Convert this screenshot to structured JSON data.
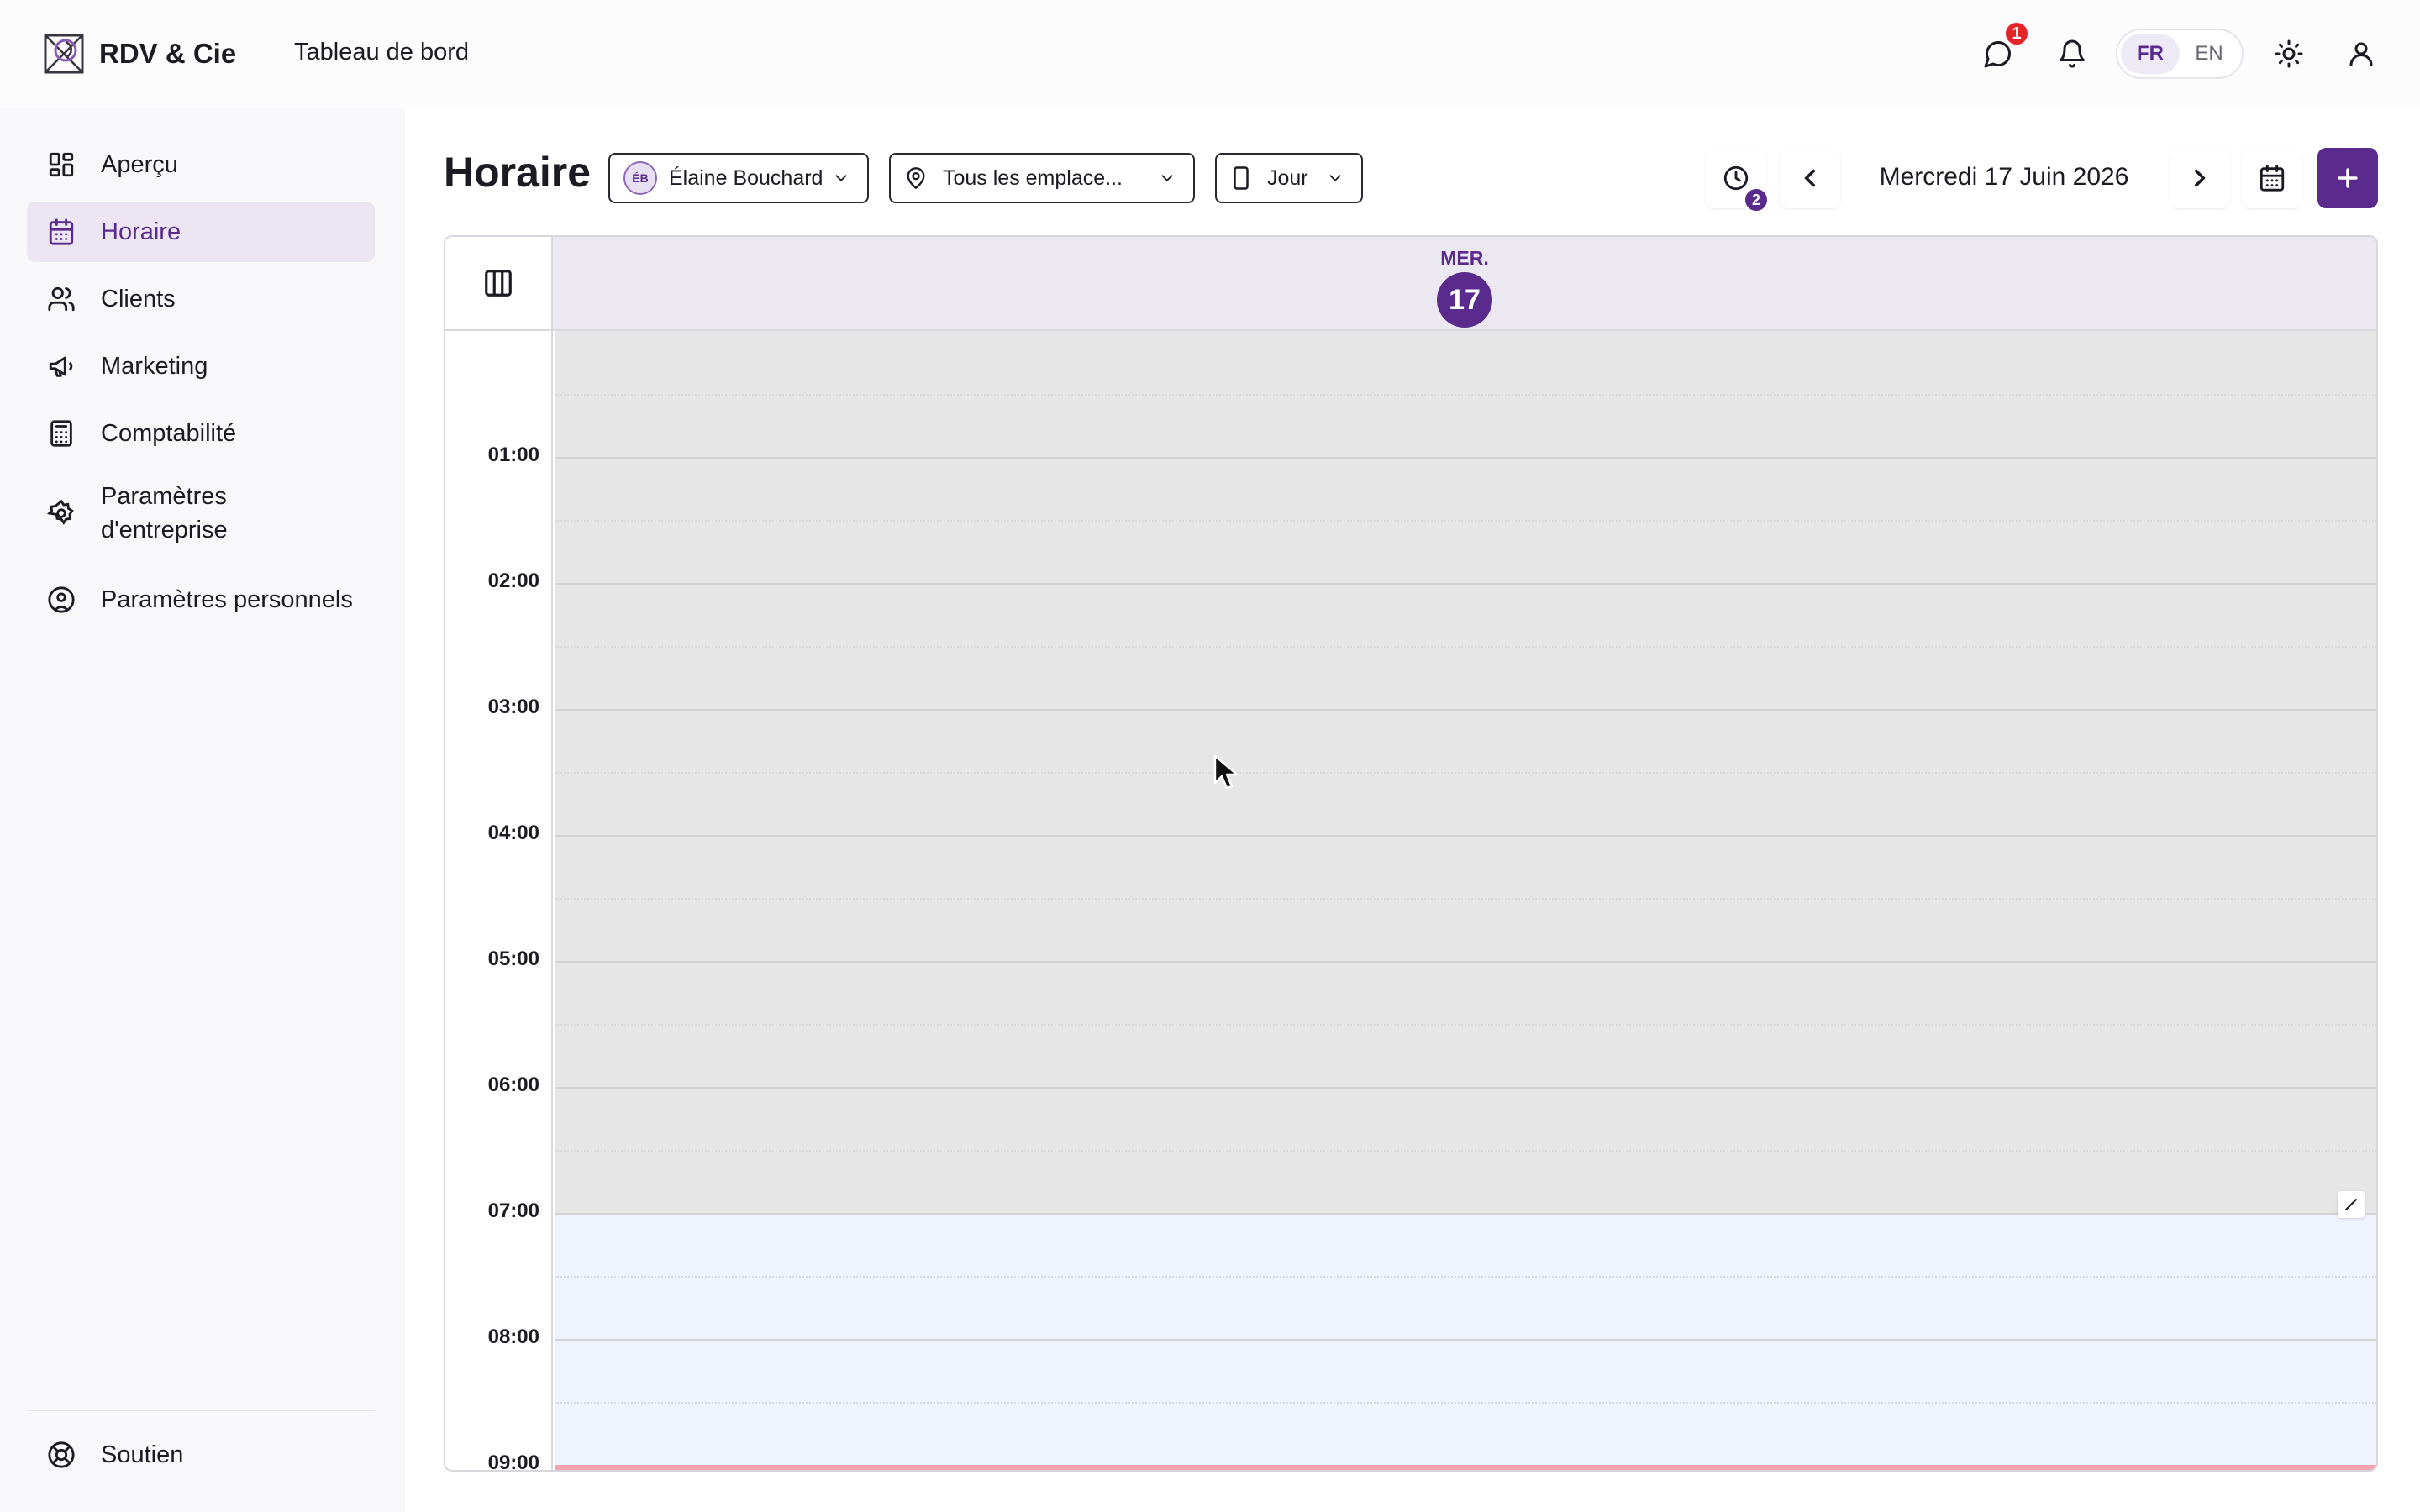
{
  "app": {
    "name": "RDV & Cie",
    "context": "Tableau de bord"
  },
  "topbar": {
    "chat_badge": "1",
    "languages": [
      "FR",
      "EN"
    ],
    "active_language": "FR"
  },
  "sidebar": {
    "items": [
      {
        "label": "Aperçu",
        "icon": "dashboard-icon"
      },
      {
        "label": "Horaire",
        "icon": "calendar-icon",
        "active": true
      },
      {
        "label": "Clients",
        "icon": "users-icon"
      },
      {
        "label": "Marketing",
        "icon": "megaphone-icon"
      },
      {
        "label": "Comptabilité",
        "icon": "calculator-icon"
      },
      {
        "label": "Paramètres d'entreprise",
        "icon": "gear-icon"
      },
      {
        "label": "Paramètres personnels",
        "icon": "user-circle-icon"
      }
    ],
    "footer": {
      "label": "Soutien",
      "icon": "lifebuoy-icon"
    }
  },
  "main": {
    "title": "Horaire",
    "staff_filter": {
      "initials": "ÉB",
      "value": "Élaine Bouchard"
    },
    "location_filter": {
      "value": "Tous les emplace..."
    },
    "view_filter": {
      "value": "Jour"
    },
    "history_badge": "2",
    "date_label": "Mercredi 17 Juin 2026"
  },
  "calendar": {
    "day_name": "MER.",
    "day_number": "17",
    "hours": [
      "01:00",
      "02:00",
      "03:00",
      "04:00",
      "05:00",
      "06:00",
      "07:00",
      "08:00",
      "09:00"
    ],
    "unavailable_until": "07:00"
  },
  "colors": {
    "accent": "#5a2a8c",
    "unavailable": "#e6e6e6",
    "available": "#eef3fd",
    "badge_red": "#e5252a"
  }
}
